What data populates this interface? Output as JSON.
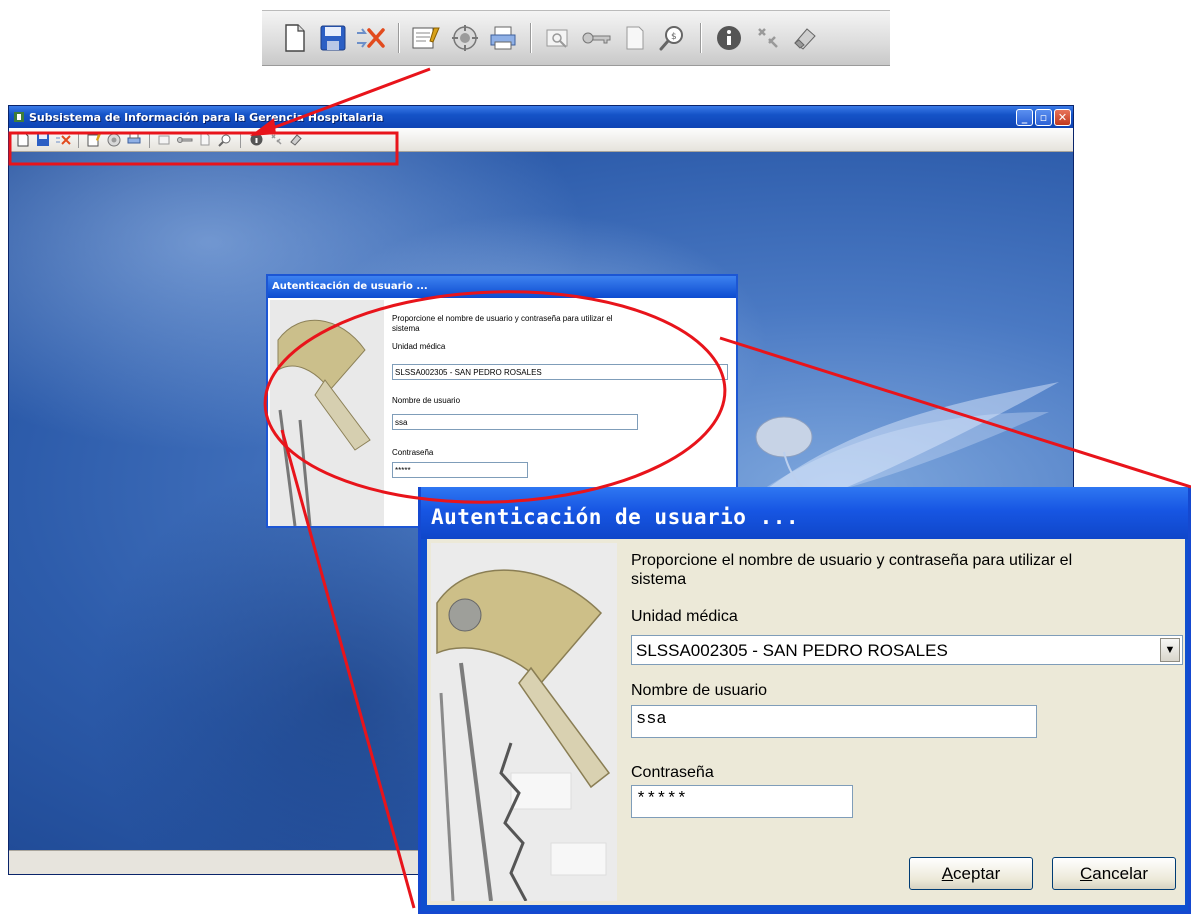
{
  "app": {
    "title": "Subsistema de Información para la Gerencia Hospitalaria",
    "window_buttons": {
      "minimize": "_",
      "maximize": "▫",
      "close": "✕"
    }
  },
  "toolbar": {
    "icons": [
      "new-document-icon",
      "save-icon",
      "delete-icon",
      "edit-icon",
      "print-setup-icon",
      "print-icon",
      "find-icon",
      "key-icon",
      "page-icon",
      "search-icon",
      "info-icon",
      "settings-icon",
      "eraser-icon"
    ]
  },
  "login_dialog": {
    "title": "Autenticación de usuario ...",
    "instructions": "Proporcione el nombre de usuario y contraseña para utilizar el sistema",
    "instructions_line1": "Proporcione el nombre de usuario y contraseña para utilizar el",
    "instructions_line2": "sistema",
    "unit_label": "Unidad médica",
    "unit_value": "SLSSA002305 - SAN PEDRO ROSALES",
    "user_label": "Nombre de usuario",
    "user_value": "ssa",
    "password_label": "Contraseña",
    "password_value": "*****",
    "accept_button": {
      "accel": "A",
      "rest": "ceptar"
    },
    "cancel_button": {
      "accel": "C",
      "rest": "ancelar"
    }
  },
  "colors": {
    "callout_red": "#e8141b",
    "titlebar_blue": "#1553c7",
    "desktop_blue": "#3464b0"
  }
}
